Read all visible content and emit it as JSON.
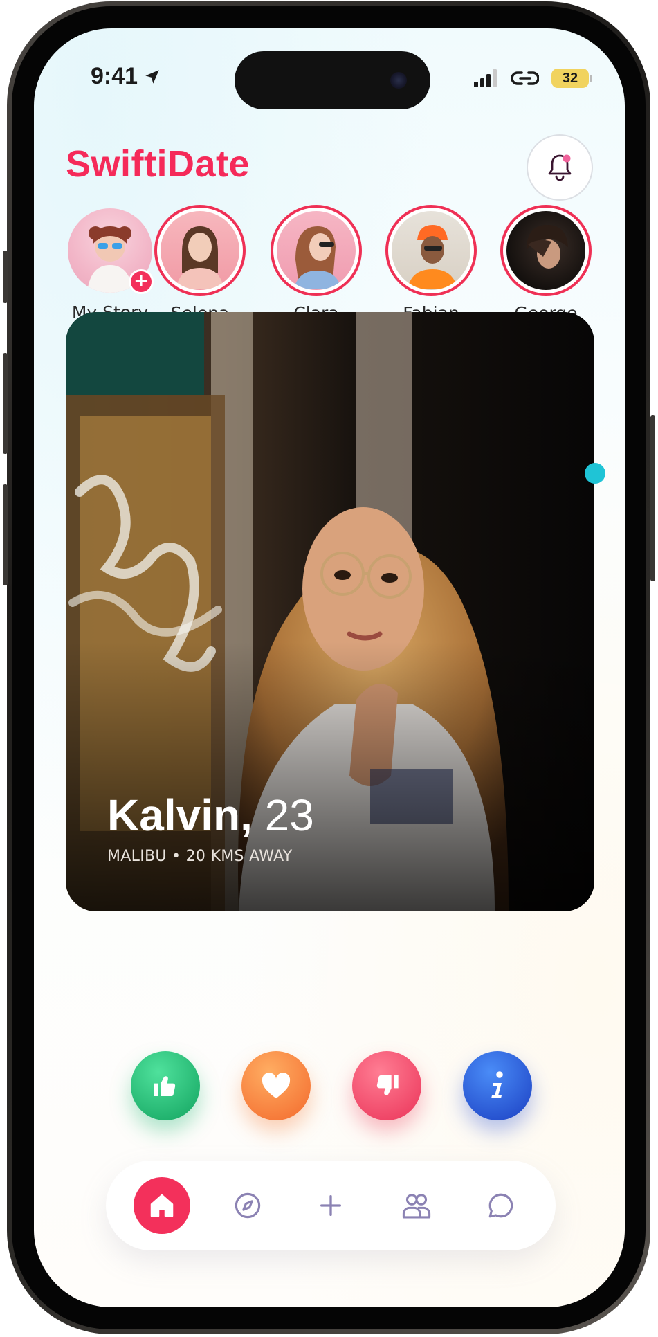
{
  "status_bar": {
    "time": "9:41",
    "battery": "32"
  },
  "header": {
    "brand": "SwiftiDate"
  },
  "stories": [
    {
      "name": "My Story"
    },
    {
      "name": "Selena"
    },
    {
      "name": "Clara"
    },
    {
      "name": "Fabian"
    },
    {
      "name": "George"
    }
  ],
  "card": {
    "name": "Kalvin,",
    "age": "23",
    "location": "MALIBU • 20 KMS AWAY"
  },
  "colors": {
    "brand": "#f52a59",
    "like": "#1cb56c",
    "love": "#f6813a",
    "dislike": "#ef4663",
    "info": "#2250d4",
    "nav_inactive": "#8b82b3"
  },
  "actions": [
    {
      "icon": "thumbs-up-icon"
    },
    {
      "icon": "heart-icon"
    },
    {
      "icon": "thumbs-down-icon"
    },
    {
      "icon": "info-icon"
    }
  ],
  "nav": [
    {
      "icon": "home-icon",
      "active": true
    },
    {
      "icon": "compass-icon"
    },
    {
      "icon": "plus-icon"
    },
    {
      "icon": "users-icon"
    },
    {
      "icon": "chat-icon"
    }
  ]
}
